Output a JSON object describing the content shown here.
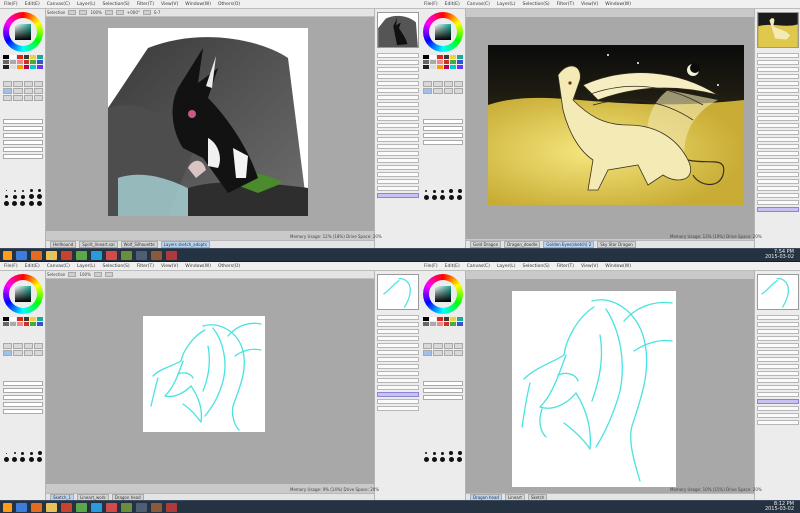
{
  "menu": [
    "File(F)",
    "Edit(E)",
    "Canvas(C)",
    "Layer(L)",
    "Selection(S)",
    "Filter(T)",
    "View(V)",
    "Window(W)",
    "Others(O)"
  ],
  "toolbar": {
    "selection_label": "Selection",
    "zoom_value": "100%",
    "angle_value": "+000°",
    "stabilizer_value": "S-7"
  },
  "quadrants": {
    "top_left": {
      "tabs": [
        "Hellhound",
        "Spirit_lineart.sai",
        "Wolf_Silhouette",
        "Layers sketch_adopts"
      ],
      "active_tab": 3,
      "status": "Memory Usage: 12% (18%)  Drive Space: 20%",
      "layers_header": "Normal"
    },
    "top_right": {
      "tabs": [
        "Gold Dragon",
        "Dragon_doodle",
        "Golden Eyes(sketch) 2",
        "Sky Star Dragon"
      ],
      "active_tab": 2,
      "status": "Memory Usage: 13% (19%)  Drive Space: 20%"
    },
    "bottom_left": {
      "tabs": [
        "Sketch_1",
        "Lineart_work",
        "Dragon head"
      ],
      "active_tab": 0,
      "status": "Memory Usage: 9% (14%)  Drive Space: 20%"
    },
    "bottom_right": {
      "tabs": [
        "Dragon head",
        "Lineart",
        "Sketch"
      ],
      "active_tab": 0,
      "status": "Memory Usage: 10% (15%)  Drive Space: 20%"
    }
  },
  "taskbar": {
    "clock_time_top": "7:54 PM",
    "clock_date_top": "2015-03-02",
    "clock_time_bottom": "8:12 PM",
    "clock_date_bottom": "2015-03-02"
  },
  "colors": {
    "sketch_line": "#47e3e0",
    "selected_layer": "#c7c2f2",
    "taskbar": "#253241",
    "workspace": "#a8a8a8"
  }
}
